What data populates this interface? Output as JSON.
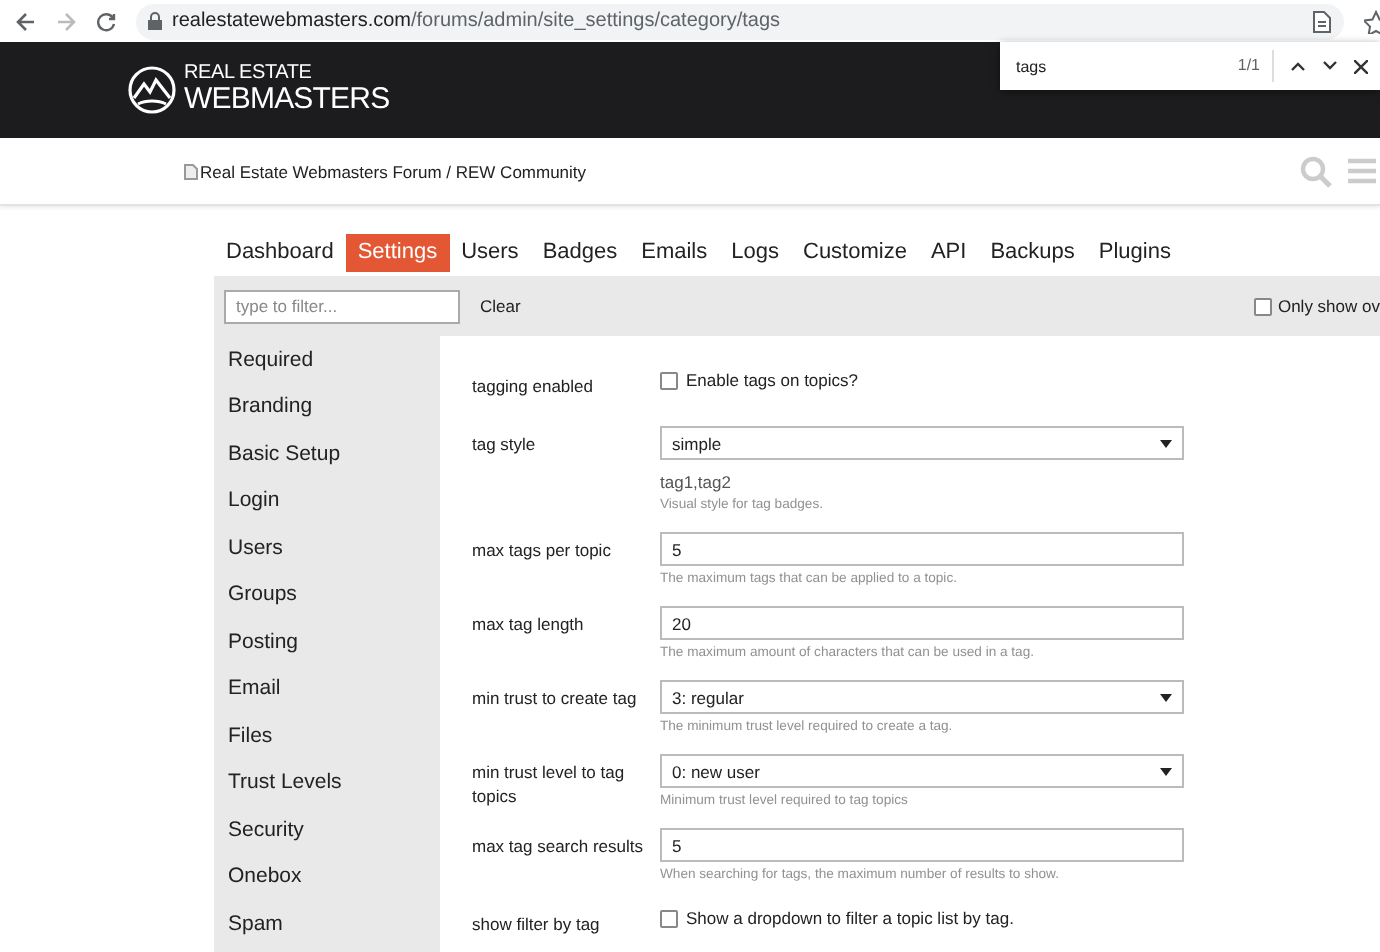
{
  "browser": {
    "url_domain": "realestatewebmasters.com",
    "url_path": "/forums/admin/site_settings/category/tags"
  },
  "find_bar": {
    "query": "tags",
    "count": "1/1"
  },
  "header": {
    "logo_line1": "REAL ESTATE",
    "logo_line2": "WEBMASTERS"
  },
  "site_bar": {
    "broken_image_alt": "Real Estate Webmasters Forum / REW Community"
  },
  "nav_tabs": [
    {
      "label": "Dashboard",
      "selected": false
    },
    {
      "label": "Settings",
      "selected": true
    },
    {
      "label": "Users",
      "selected": false
    },
    {
      "label": "Badges",
      "selected": false
    },
    {
      "label": "Emails",
      "selected": false
    },
    {
      "label": "Logs",
      "selected": false
    },
    {
      "label": "Customize",
      "selected": false
    },
    {
      "label": "API",
      "selected": false
    },
    {
      "label": "Backups",
      "selected": false
    },
    {
      "label": "Plugins",
      "selected": false
    }
  ],
  "filter_bar": {
    "placeholder": "type to filter...",
    "clear": "Clear",
    "only_show": "Only show ov",
    "only_show_checked": false
  },
  "sidebar": {
    "items": [
      "Required",
      "Branding",
      "Basic Setup",
      "Login",
      "Users",
      "Groups",
      "Posting",
      "Email",
      "Files",
      "Trust Levels",
      "Security",
      "Onebox",
      "Spam"
    ]
  },
  "settings": [
    {
      "kind": "checkbox",
      "label": "tagging enabled",
      "text": "Enable tags on topics?",
      "checked": false
    },
    {
      "kind": "select",
      "label": "tag style",
      "value": "simple",
      "preview": "tag1,tag2",
      "hint": "Visual style for tag badges."
    },
    {
      "kind": "text",
      "label": "max tags per topic",
      "value": "5",
      "hint": "The maximum tags that can be applied to a topic."
    },
    {
      "kind": "text",
      "label": "max tag length",
      "value": "20",
      "hint": "The maximum amount of characters that can be used in a tag."
    },
    {
      "kind": "select",
      "label": "min trust to create tag",
      "value": "3: regular",
      "hint": "The minimum trust level required to create a tag."
    },
    {
      "kind": "select",
      "label": "min trust level to tag topics",
      "value": "0: new user",
      "hint": "Minimum trust level required to tag topics"
    },
    {
      "kind": "text",
      "label": "max tag search results",
      "value": "5",
      "hint": "When searching for tags, the maximum number of results to show."
    },
    {
      "kind": "checkbox",
      "label": "show filter by tag",
      "text": "Show a dropdown to filter a topic list by tag.",
      "checked": false
    }
  ]
}
